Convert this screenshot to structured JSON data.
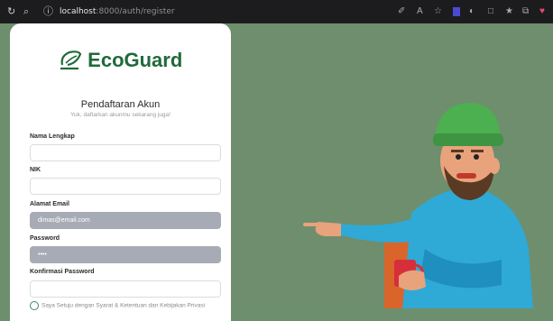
{
  "browser": {
    "url_host": "localhost",
    "url_path": ":8000/auth/register"
  },
  "brand": {
    "name": "EcoGuard"
  },
  "form": {
    "title": "Pendaftaran Akun",
    "subtitle": "Yuk, daftarkan akunmu sekarang juga!",
    "fields": [
      {
        "label": "Nama Lengkap",
        "value": ""
      },
      {
        "label": "NIK",
        "value": ""
      },
      {
        "label": "Alamat Email",
        "value": "dimas@email.com"
      },
      {
        "label": "Password",
        "value": "••••"
      },
      {
        "label": "Konfirmasi Password",
        "value": ""
      }
    ],
    "agree_label": "Saya Setuju dengan Syarat & Ketentuan dan Kebijakan Privasi"
  },
  "colors": {
    "brand_green": "#1f6a3a",
    "background": "#6f8e6d"
  }
}
